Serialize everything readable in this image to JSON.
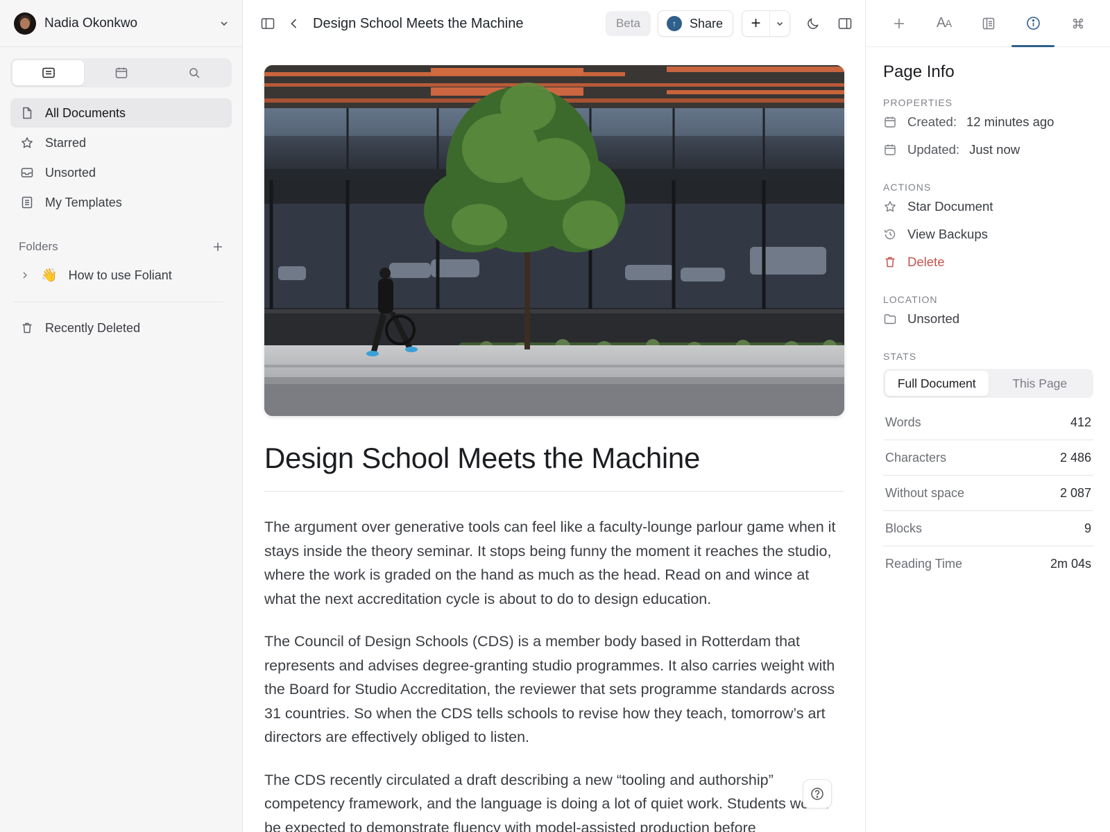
{
  "user": {
    "name": "Nadia Okonkwo"
  },
  "sidebar": {
    "nav": [
      {
        "label": "All Documents",
        "icon": "document-icon",
        "active": true
      },
      {
        "label": "Starred",
        "icon": "star-icon"
      },
      {
        "label": "Unsorted",
        "icon": "inbox-icon"
      },
      {
        "label": "My Templates",
        "icon": "template-icon"
      }
    ],
    "folders_label": "Folders",
    "folders": [
      {
        "emoji": "👋",
        "label": "How to use Foliant"
      }
    ],
    "recently_deleted": "Recently Deleted"
  },
  "topbar": {
    "title": "Design School Meets the Machine",
    "beta": "Beta",
    "share": "Share",
    "plus": "+"
  },
  "article": {
    "title": "Design School Meets the Machine",
    "paragraphs": [
      "The argument over generative tools can feel like a faculty-lounge parlour game when it stays inside the theory seminar. It stops being funny the moment it reaches the studio, where the work is graded on the hand as much as the head. Read on and wince at what the next accreditation cycle is about to do to design education.",
      "The Council of Design Schools (CDS) is a member body based in Rotterdam that represents and advises degree-granting studio programmes. It also carries weight with the Board for Studio Accreditation, the reviewer that sets programme standards across 31 countries. So when the CDS tells schools to revise how they teach, tomorrow’s art directors are effectively obliged to listen.",
      "The CDS recently circulated a draft describing a new “tooling and authorship” competency framework, and the language is doing a lot of quiet work. Students would be expected to demonstrate fluency with model-assisted production before"
    ]
  },
  "panel": {
    "heading": "Page Info",
    "properties_label": "Properties",
    "created_key": "Created:",
    "created_value": "12 minutes ago",
    "updated_key": "Updated:",
    "updated_value": "Just now",
    "actions_label": "Actions",
    "actions": [
      {
        "label": "Star Document",
        "icon": "star-icon"
      },
      {
        "label": "View Backups",
        "icon": "history-icon"
      },
      {
        "label": "Delete",
        "icon": "trash-icon",
        "danger": true
      }
    ],
    "location_label": "Location",
    "location_value": "Unsorted",
    "stats_label": "Stats",
    "stats_tabs": [
      "Full Document",
      "This Page"
    ],
    "stats_active_tab": "Full Document",
    "stats": [
      {
        "label": "Words",
        "value": "412"
      },
      {
        "label": "Characters",
        "value": "2 486"
      },
      {
        "label": "Without space",
        "value": "2 087"
      },
      {
        "label": "Blocks",
        "value": "9"
      },
      {
        "label": "Reading Time",
        "value": "2m 04s"
      }
    ],
    "tabs": [
      "add-icon",
      "typography-icon",
      "outline-icon",
      "info-icon",
      "command-icon"
    ],
    "active_tab": "info-icon"
  },
  "colors": {
    "accent": "#2f5f8a",
    "danger": "#c5534e",
    "sidebar_bg": "#f6f6f7"
  }
}
